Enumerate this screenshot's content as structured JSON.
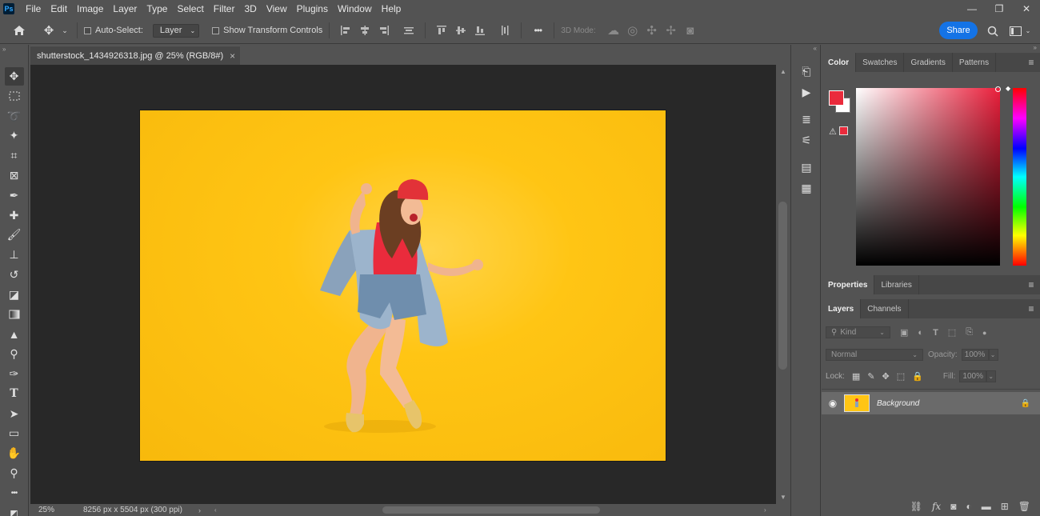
{
  "app": {
    "logo": "Ps"
  },
  "menu": [
    "File",
    "Edit",
    "Image",
    "Layer",
    "Type",
    "Select",
    "Filter",
    "3D",
    "View",
    "Plugins",
    "Window",
    "Help"
  ],
  "options": {
    "auto_select_label": "Auto-Select:",
    "auto_select_value": "Layer",
    "show_transform_label": "Show Transform Controls",
    "mode_3d_label": "3D Mode:",
    "share_label": "Share",
    "more": "•••"
  },
  "document": {
    "tab_title": "shutterstock_1434926318.jpg @ 25% (RGB/8#)",
    "close": "×",
    "zoom": "25%",
    "dimensions": "8256 px x 5504 px (300 ppi)"
  },
  "color_panel": {
    "tabs": [
      "Color",
      "Swatches",
      "Gradients",
      "Patterns"
    ],
    "foreground": "#ea2b3c",
    "background": "#ffffff"
  },
  "properties_panel": {
    "tabs": [
      "Properties",
      "Libraries"
    ]
  },
  "layers_panel": {
    "tabs": [
      "Layers",
      "Channels"
    ],
    "filter_kind": "Kind",
    "blend_mode": "Normal",
    "opacity_label": "Opacity:",
    "opacity_value": "100%",
    "lock_label": "Lock:",
    "fill_label": "Fill:",
    "fill_value": "100%",
    "layers": [
      {
        "name": "Background",
        "visible": true,
        "locked": true
      }
    ]
  },
  "colors": {
    "accent": "#1473e6",
    "canvas_bg": "#282828",
    "ui_bg": "#535353",
    "image_yellow": "#ffc514"
  }
}
